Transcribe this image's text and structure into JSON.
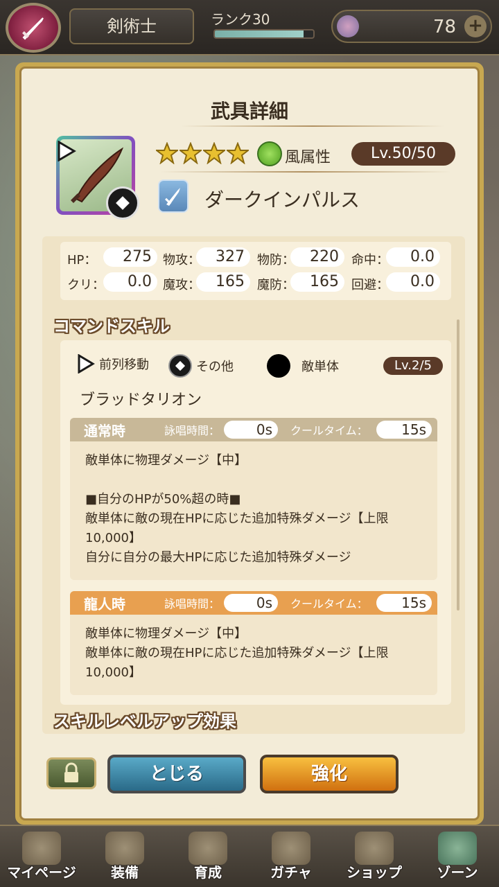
{
  "top_bar": {
    "job_name": "剣術士",
    "rank_label": "ランク30",
    "rank_progress": 0.9,
    "gem_count": "78"
  },
  "panel": {
    "title": "武具詳細",
    "attribute": "風属性",
    "level": "Lv.50/50",
    "weapon_name": "ダークインパルス"
  },
  "stats": [
    {
      "label": "HP：",
      "value": "275"
    },
    {
      "label": "物攻：",
      "value": "327"
    },
    {
      "label": "物防：",
      "value": "220"
    },
    {
      "label": "命中：",
      "value": "0.0"
    },
    {
      "label": "クリ：",
      "value": "0.0"
    },
    {
      "label": "魔攻：",
      "value": "165"
    },
    {
      "label": "魔防：",
      "value": "165"
    },
    {
      "label": "回避：",
      "value": "0.0"
    }
  ],
  "command_skill": {
    "section_title": "コマンドスキル",
    "tags": [
      "前列移動",
      "その他",
      "敵単体"
    ],
    "level": "Lv.2/5",
    "name": "ブラッドタリオン",
    "normal": {
      "title": "通常時",
      "cast_label": "詠唱時間：",
      "cast_value": "0s",
      "cooldown_label": "クールタイム：",
      "cooldown_value": "15s",
      "lines": [
        "敵単体に物理ダメージ【中】",
        "",
        "■自分のHPが50%超の時■",
        "敵単体に敵の現在HPに応じた追加特殊ダメージ【上限",
        "10,000】",
        "自分に自分の最大HPに応じた追加特殊ダメージ"
      ]
    },
    "dragon": {
      "title": "龍人時",
      "cast_label": "詠唱時間：",
      "cast_value": "0s",
      "cooldown_label": "クールタイム：",
      "cooldown_value": "15s",
      "lines": [
        "敵単体に物理ダメージ【中】",
        "敵単体に敵の現在HPに応じた追加特殊ダメージ【上限",
        "10,000】"
      ]
    }
  },
  "skill_levelup_title": "スキルレベルアップ効果",
  "buttons": {
    "close": "とじる",
    "enhance": "強化"
  },
  "nav": [
    {
      "label": "マイページ",
      "icon": "scroll-icon"
    },
    {
      "label": "装備",
      "icon": "helmet-icon"
    },
    {
      "label": "育成",
      "icon": "crossed-swords-icon"
    },
    {
      "label": "ガチャ",
      "icon": "bag-icon"
    },
    {
      "label": "ショップ",
      "icon": "coin-icon"
    },
    {
      "label": "ゾーン",
      "icon": "globe-icon"
    }
  ],
  "colors": {
    "panel_bg": "#f3ecd8",
    "frame_gold": "#c8a850",
    "level_pill": "#5a3a28",
    "dragon_header": "#e8a050",
    "normal_header": "#c8b898"
  }
}
